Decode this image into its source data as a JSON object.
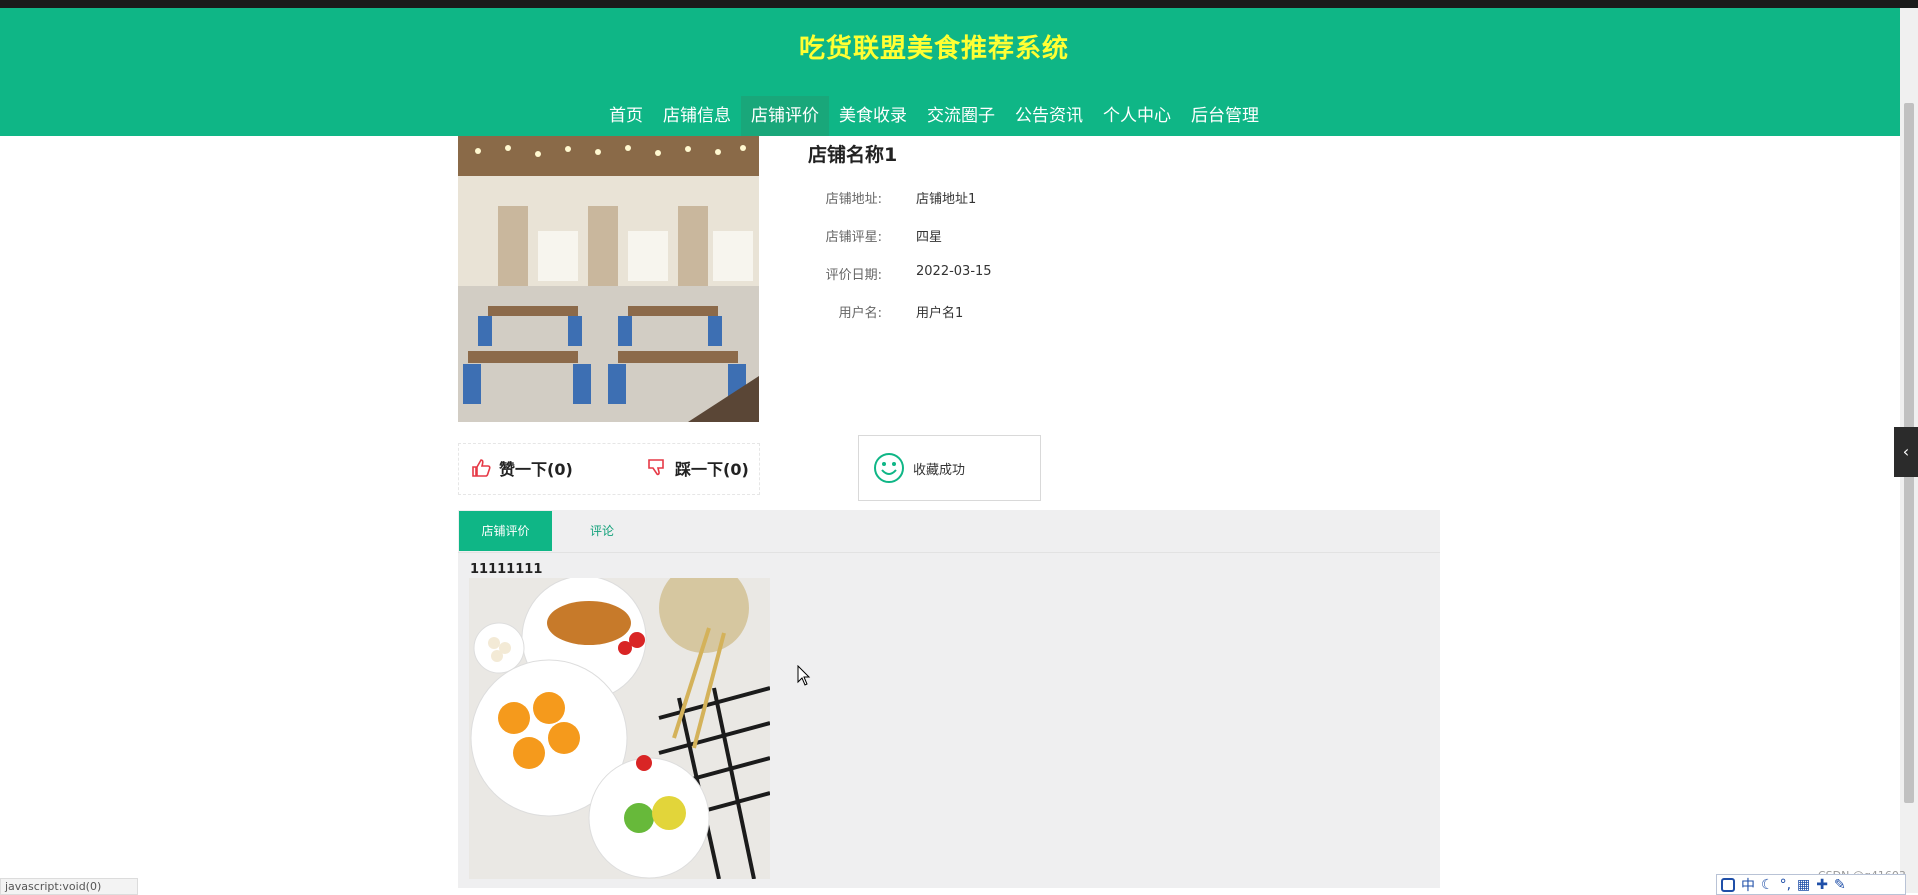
{
  "site": {
    "title": "吃货联盟美食推荐系统"
  },
  "nav": {
    "items": [
      {
        "label": "首页"
      },
      {
        "label": "店铺信息"
      },
      {
        "label": "店铺评价",
        "active": true
      },
      {
        "label": "美食收录"
      },
      {
        "label": "交流圈子"
      },
      {
        "label": "公告资讯"
      },
      {
        "label": "个人中心"
      },
      {
        "label": "后台管理"
      }
    ]
  },
  "shop": {
    "name": "店铺名称1",
    "fields": [
      {
        "label": "店铺地址:",
        "value": "店铺地址1"
      },
      {
        "label": "店铺评星:",
        "value": "四星"
      },
      {
        "label": "评价日期:",
        "value": "2022-03-15"
      },
      {
        "label": "用户名:",
        "value": "用户名1"
      }
    ]
  },
  "votes": {
    "like_label": "赞一下(0)",
    "dislike_label": "踩一下(0)"
  },
  "toast": {
    "message": "收藏成功"
  },
  "tabs": [
    {
      "label": "店铺评价",
      "active": true
    },
    {
      "label": "评论",
      "active": false
    }
  ],
  "review": {
    "text": "11111111"
  },
  "statusbar": {
    "text": "javascript:void(0)"
  },
  "ime": {
    "mode_label": "中"
  },
  "watermark": {
    "text": "CSDN @q41603"
  },
  "colors": {
    "brand": "#0fb686",
    "title": "#ffff33",
    "accent_red": "#e63946"
  }
}
